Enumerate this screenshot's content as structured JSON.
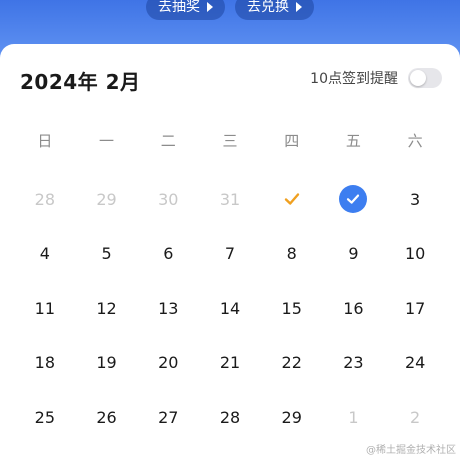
{
  "top_buttons": {
    "lottery_label": "去抽奖",
    "exchange_label": "去兑换"
  },
  "calendar": {
    "month_title": "2024年 2月",
    "reminder_label": "10点签到提醒",
    "reminder_enabled": false,
    "weekdays": [
      "日",
      "一",
      "二",
      "三",
      "四",
      "五",
      "六"
    ],
    "days": [
      {
        "label": "28",
        "muted": true
      },
      {
        "label": "29",
        "muted": true
      },
      {
        "label": "30",
        "muted": true
      },
      {
        "label": "31",
        "muted": true
      },
      {
        "label": "",
        "mark": "checkmark-orange"
      },
      {
        "label": "",
        "mark": "checkmark-blue-circle"
      },
      {
        "label": "3"
      },
      {
        "label": "4"
      },
      {
        "label": "5"
      },
      {
        "label": "6"
      },
      {
        "label": "7"
      },
      {
        "label": "8"
      },
      {
        "label": "9"
      },
      {
        "label": "10"
      },
      {
        "label": "11"
      },
      {
        "label": "12"
      },
      {
        "label": "13"
      },
      {
        "label": "14"
      },
      {
        "label": "15"
      },
      {
        "label": "16"
      },
      {
        "label": "17"
      },
      {
        "label": "18"
      },
      {
        "label": "19"
      },
      {
        "label": "20"
      },
      {
        "label": "21"
      },
      {
        "label": "22"
      },
      {
        "label": "23"
      },
      {
        "label": "24"
      },
      {
        "label": "25"
      },
      {
        "label": "26"
      },
      {
        "label": "27"
      },
      {
        "label": "28"
      },
      {
        "label": "29"
      },
      {
        "label": "1",
        "muted": true
      },
      {
        "label": "2",
        "muted": true
      }
    ]
  },
  "colors": {
    "accent_blue": "#3d7ef0",
    "check_orange": "#f0a020"
  },
  "watermark": "@稀土掘金技术社区"
}
